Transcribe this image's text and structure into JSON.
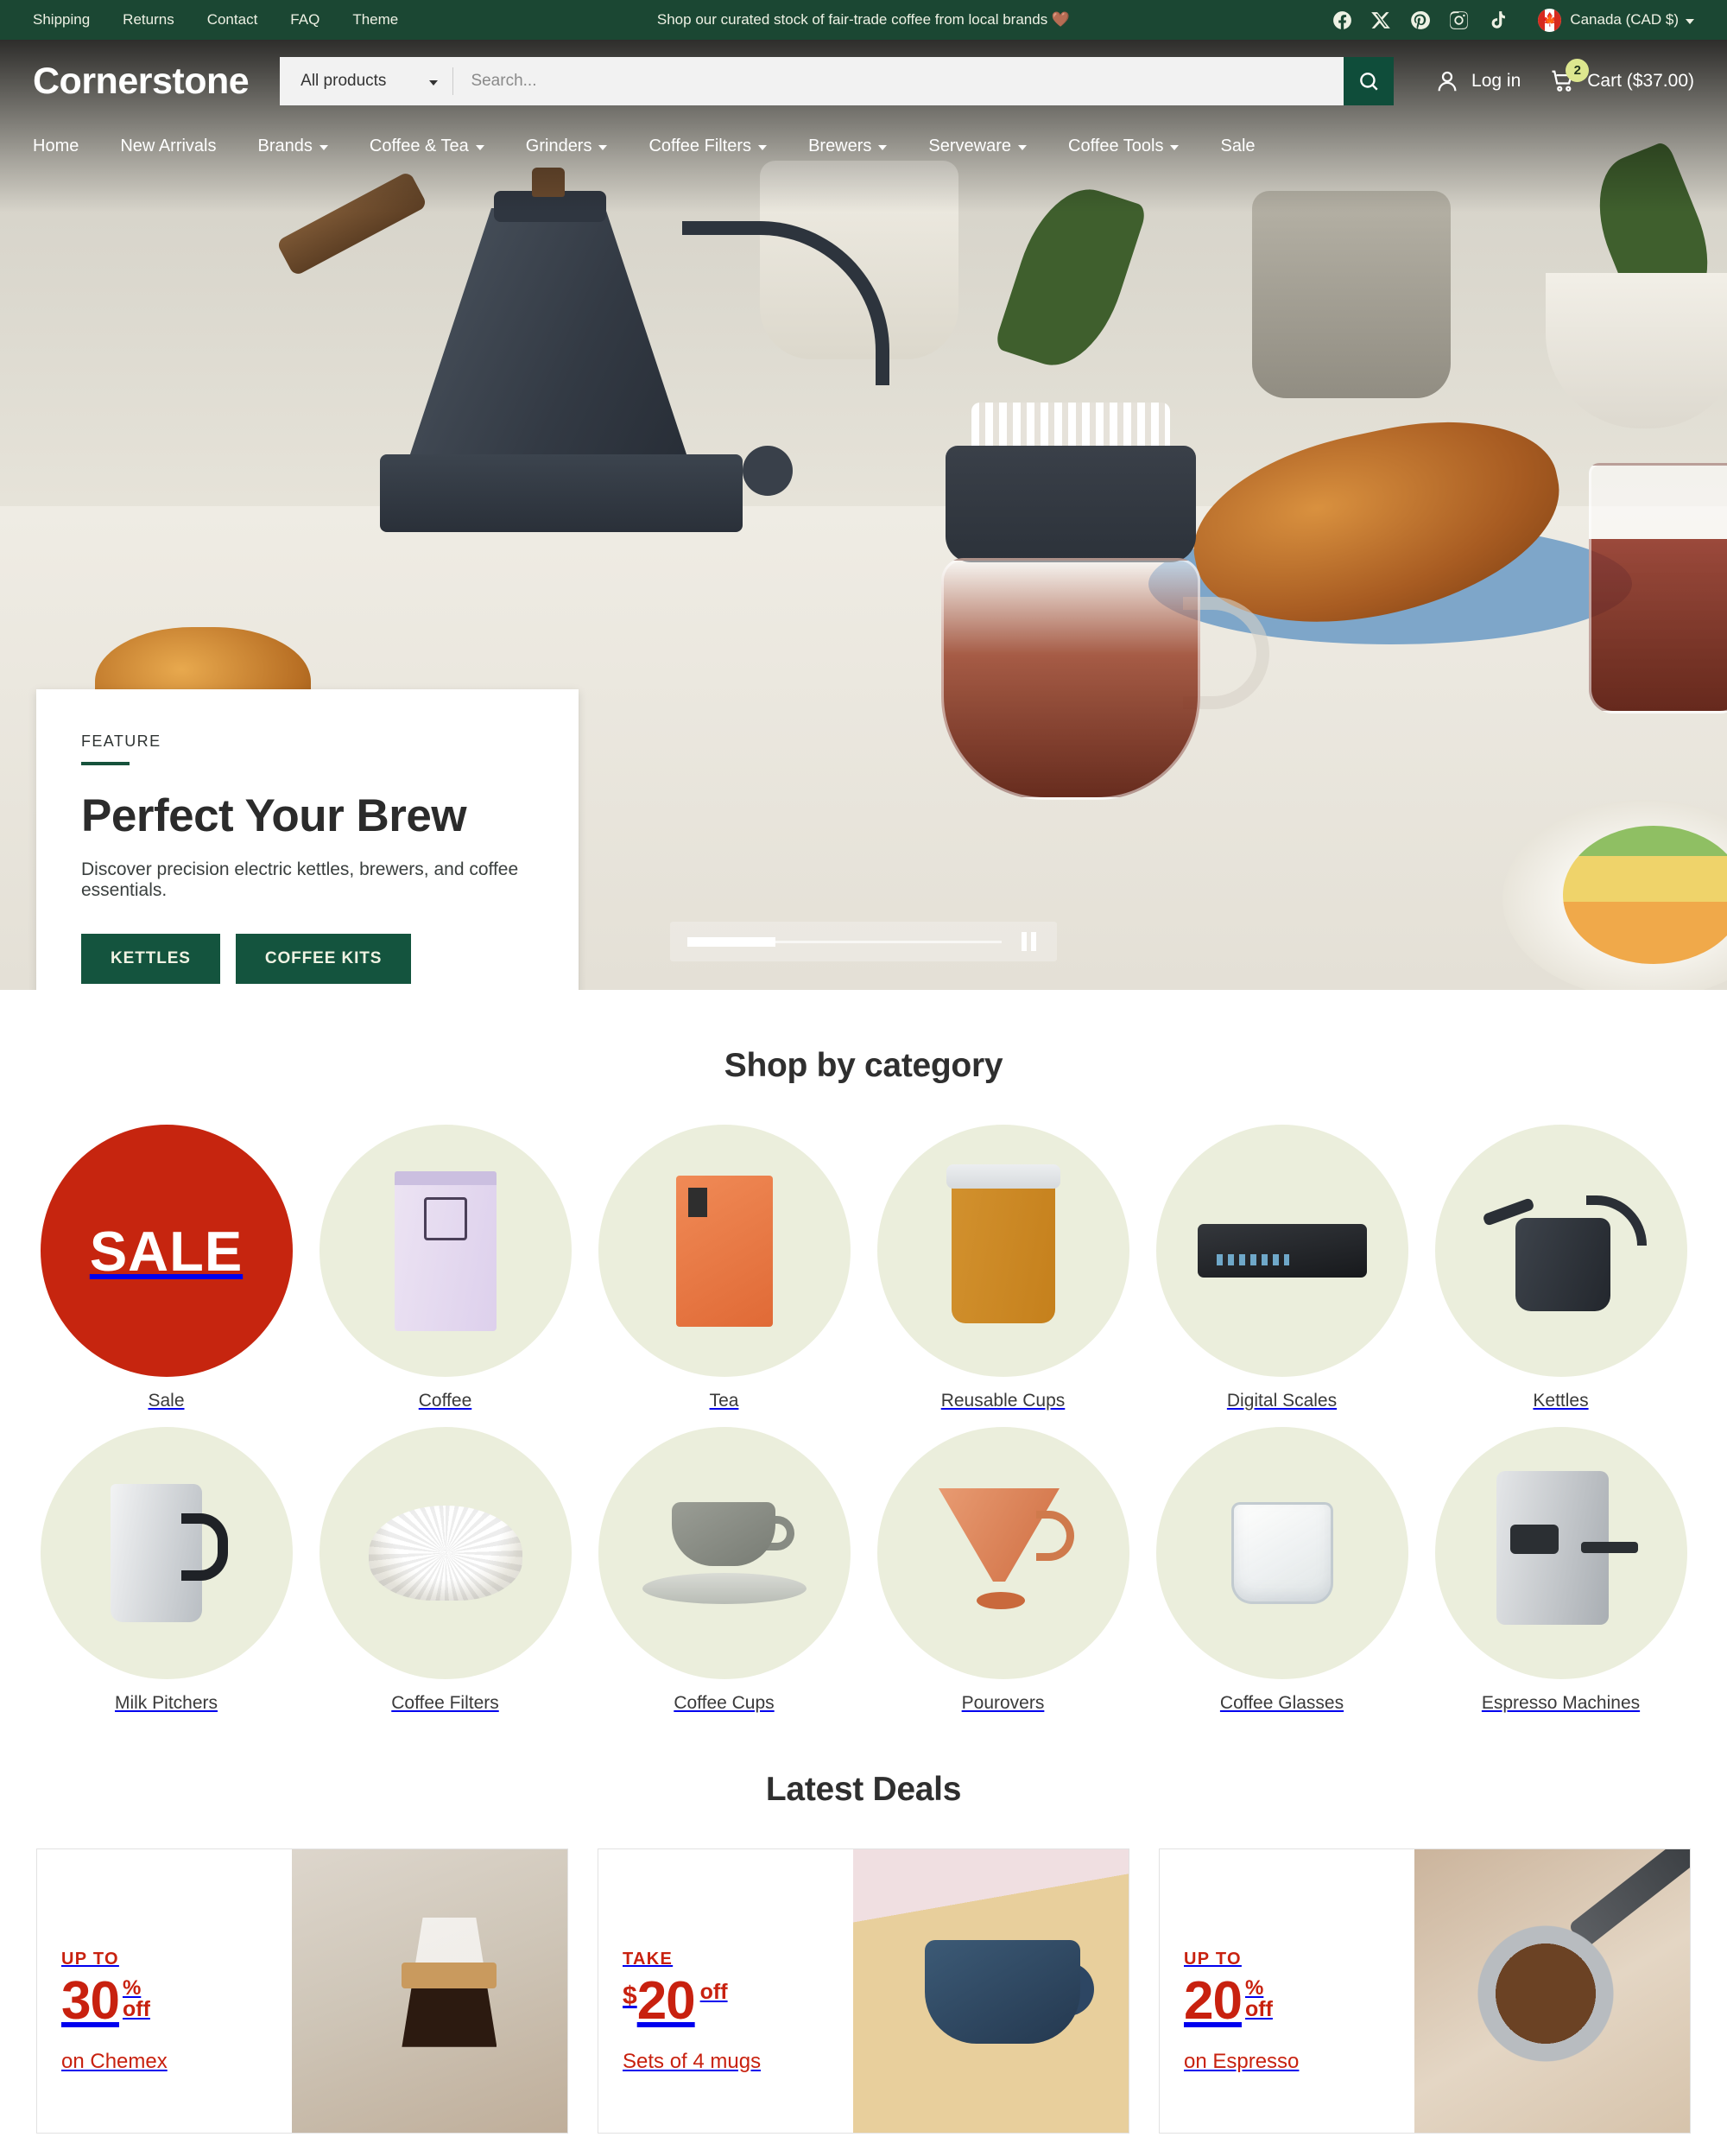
{
  "topbar": {
    "links": [
      "Shipping",
      "Returns",
      "Contact",
      "FAQ",
      "Theme"
    ],
    "message": "Shop our curated stock of fair-trade coffee from local brands 🤎",
    "socials": [
      "facebook-icon",
      "x-icon",
      "pinterest-icon",
      "instagram-icon",
      "tiktok-icon"
    ],
    "currency": "Canada (CAD $)",
    "flag": "canada-flag-icon"
  },
  "header": {
    "logo": "Cornerstone",
    "search": {
      "category": "All products",
      "placeholder": "Search...",
      "value": ""
    },
    "login_label": "Log in",
    "cart_label": "Cart ($37.00)",
    "cart_count": "2"
  },
  "nav": [
    {
      "label": "Home",
      "has_menu": false
    },
    {
      "label": "New Arrivals",
      "has_menu": false
    },
    {
      "label": "Brands",
      "has_menu": true
    },
    {
      "label": "Coffee & Tea",
      "has_menu": true
    },
    {
      "label": "Grinders",
      "has_menu": true
    },
    {
      "label": "Coffee Filters",
      "has_menu": true
    },
    {
      "label": "Brewers",
      "has_menu": true
    },
    {
      "label": "Serveware",
      "has_menu": true
    },
    {
      "label": "Coffee Tools",
      "has_menu": true
    },
    {
      "label": "Sale",
      "has_menu": false
    }
  ],
  "hero": {
    "eyebrow": "FEATURE",
    "title": "Perfect Your Brew",
    "subtitle": "Discover precision electric kettles, brewers, and coffee essentials.",
    "buttons": [
      "Kettles",
      "Coffee Kits"
    ],
    "carousel": {
      "progress": "28",
      "state": "pause"
    }
  },
  "categories": {
    "title": "Shop by category",
    "items": [
      {
        "label": "Sale",
        "art": "sale-badge",
        "badge_text": "SALE"
      },
      {
        "label": "Coffee",
        "art": "coffee-bag"
      },
      {
        "label": "Tea",
        "art": "tea-pouch"
      },
      {
        "label": "Reusable Cups",
        "art": "reusable-cup"
      },
      {
        "label": "Digital Scales",
        "art": "digital-scale"
      },
      {
        "label": "Kettles",
        "art": "gooseneck-kettle"
      },
      {
        "label": "Milk Pitchers",
        "art": "milk-pitcher"
      },
      {
        "label": "Coffee Filters",
        "art": "paper-filter"
      },
      {
        "label": "Coffee Cups",
        "art": "cup-and-saucer"
      },
      {
        "label": "Pourovers",
        "art": "pourover-cone"
      },
      {
        "label": "Coffee Glasses",
        "art": "coffee-glass"
      },
      {
        "label": "Espresso Machines",
        "art": "espresso-machine"
      }
    ]
  },
  "deals": {
    "title": "Latest Deals",
    "items": [
      {
        "kicker": "UP TO",
        "currency": "",
        "amount": "30",
        "percent": "%",
        "off": "off",
        "desc": "on Chemex",
        "photo": "chemex-photo"
      },
      {
        "kicker": "TAKE",
        "currency": "$",
        "amount": "20",
        "percent": "",
        "off": "off",
        "desc": "Sets of 4 mugs",
        "photo": "blue-mug-photo"
      },
      {
        "kicker": "UP TO",
        "currency": "",
        "amount": "20",
        "percent": "%",
        "off": "off",
        "desc": "on Espresso",
        "photo": "portafilter-photo"
      }
    ]
  },
  "colors": {
    "brand_green": "#1b4733",
    "button_green": "#14543e",
    "sale_red": "#c6250f",
    "deal_red": "#c8210f",
    "category_circle": "#ebeedc",
    "cart_badge": "#dde78f"
  }
}
